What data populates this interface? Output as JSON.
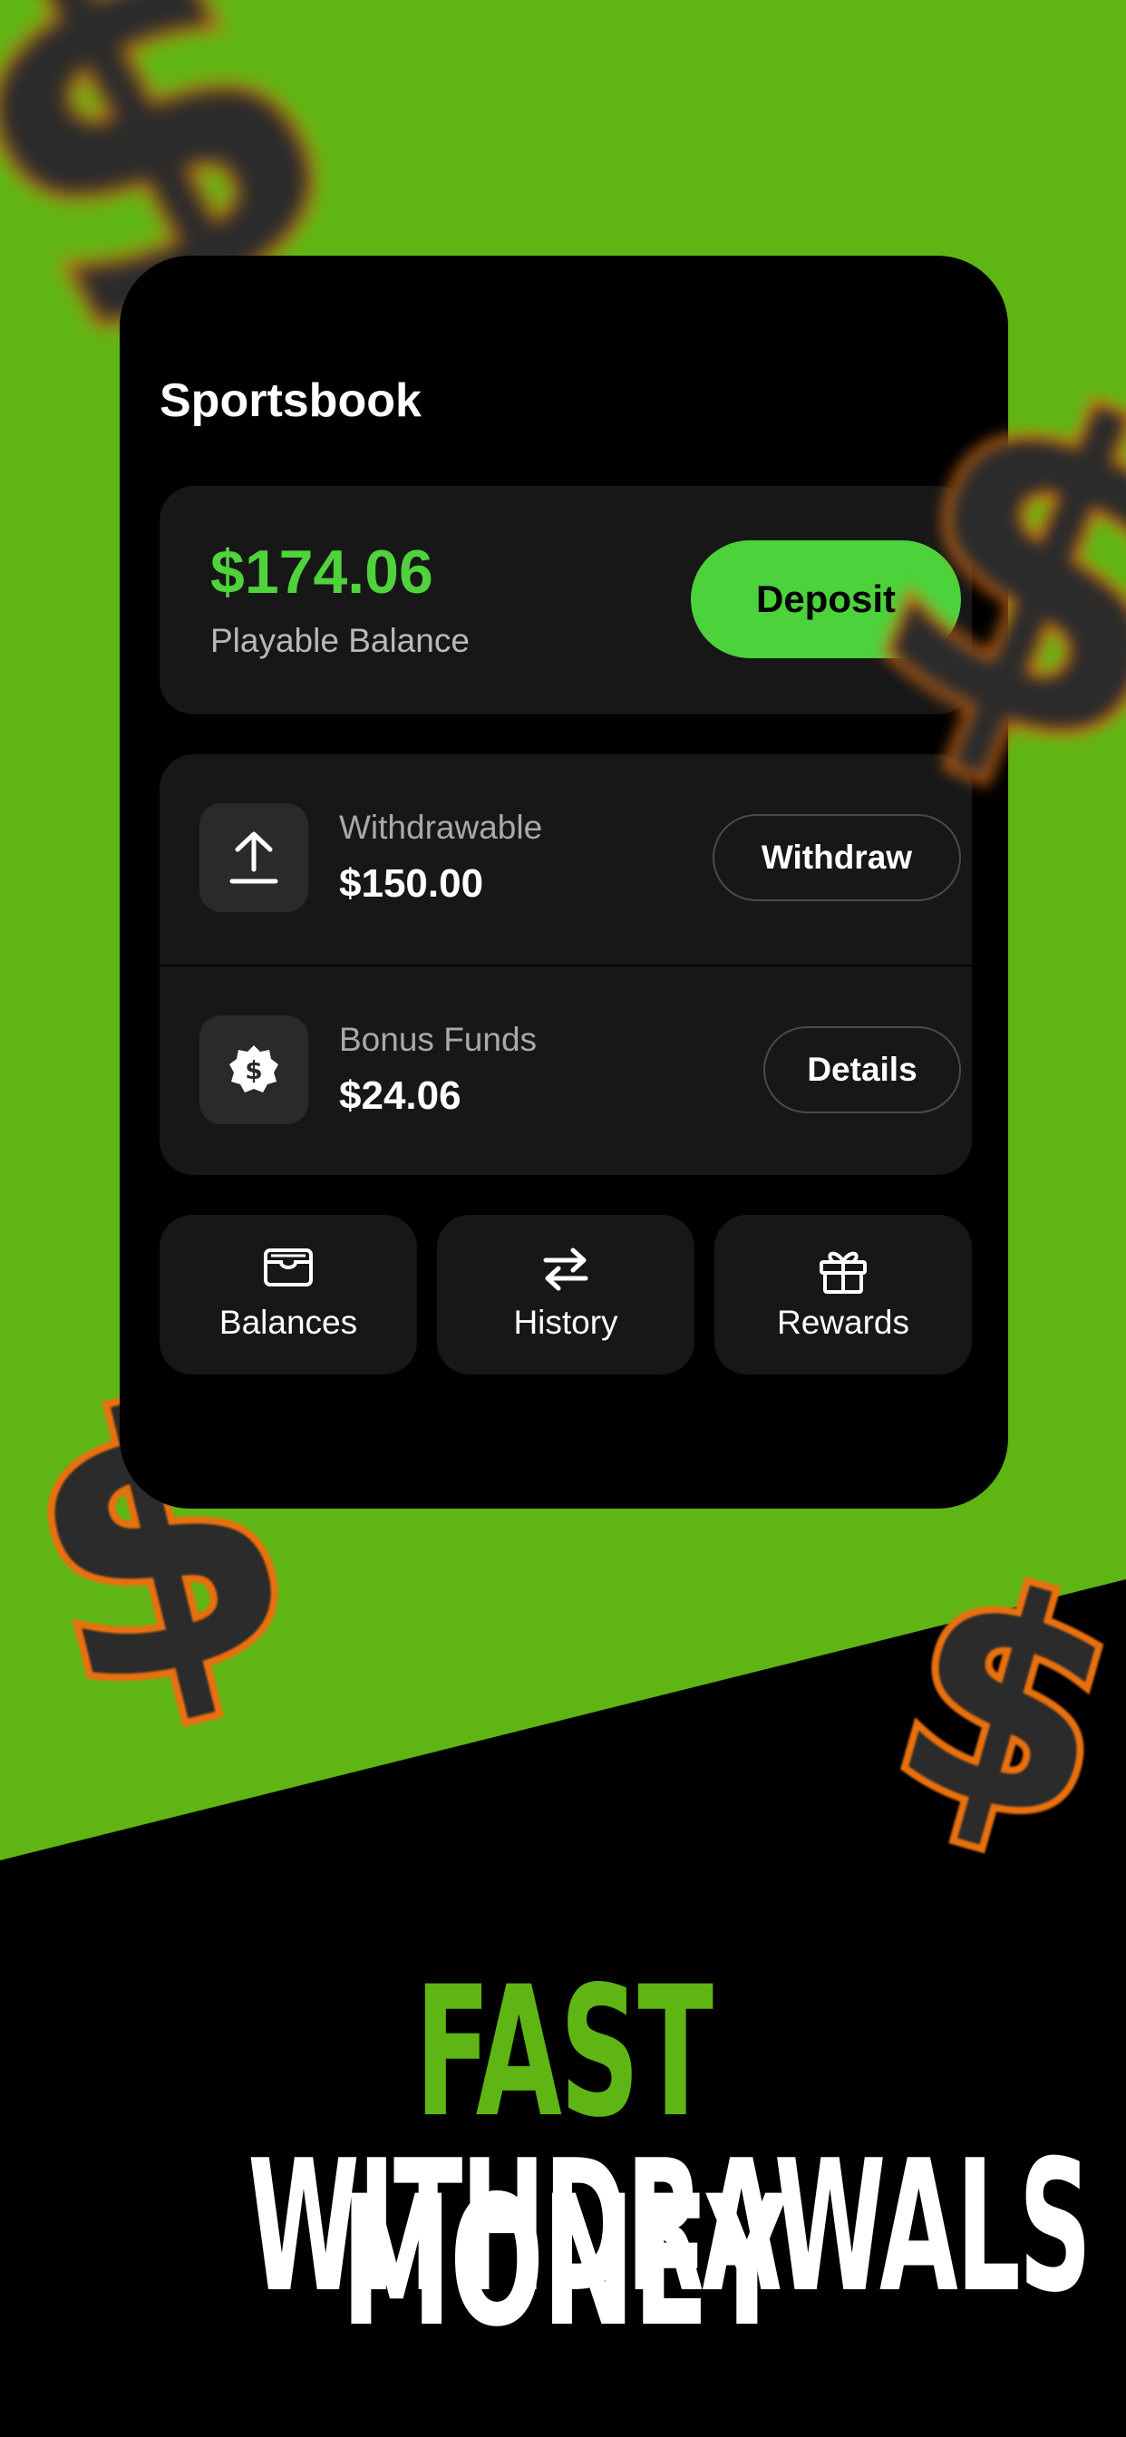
{
  "colors": {
    "background_green": "#5fb514",
    "accent_green": "#4cd23b",
    "dollar_orange": "#e8700e"
  },
  "decor": {
    "dollar_glyph": "$"
  },
  "app": {
    "title": "Sportsbook"
  },
  "balance": {
    "amount": "$174.06",
    "label": "Playable Balance",
    "deposit_label": "Deposit"
  },
  "funds": [
    {
      "label": "Withdrawable",
      "value": "$150.00",
      "button": "Withdraw",
      "icon": "upload-icon"
    },
    {
      "label": "Bonus Funds",
      "value": "$24.06",
      "button": "Details",
      "icon": "bonus-badge-icon"
    }
  ],
  "tiles": [
    {
      "label": "Balances",
      "icon": "wallet-icon"
    },
    {
      "label": "History",
      "icon": "transfer-arrows-icon"
    },
    {
      "label": "Rewards",
      "icon": "gift-icon"
    }
  ],
  "headline": {
    "word1": "FAST",
    "word2": "MONEY",
    "line2": "WITHDRAWALS"
  }
}
